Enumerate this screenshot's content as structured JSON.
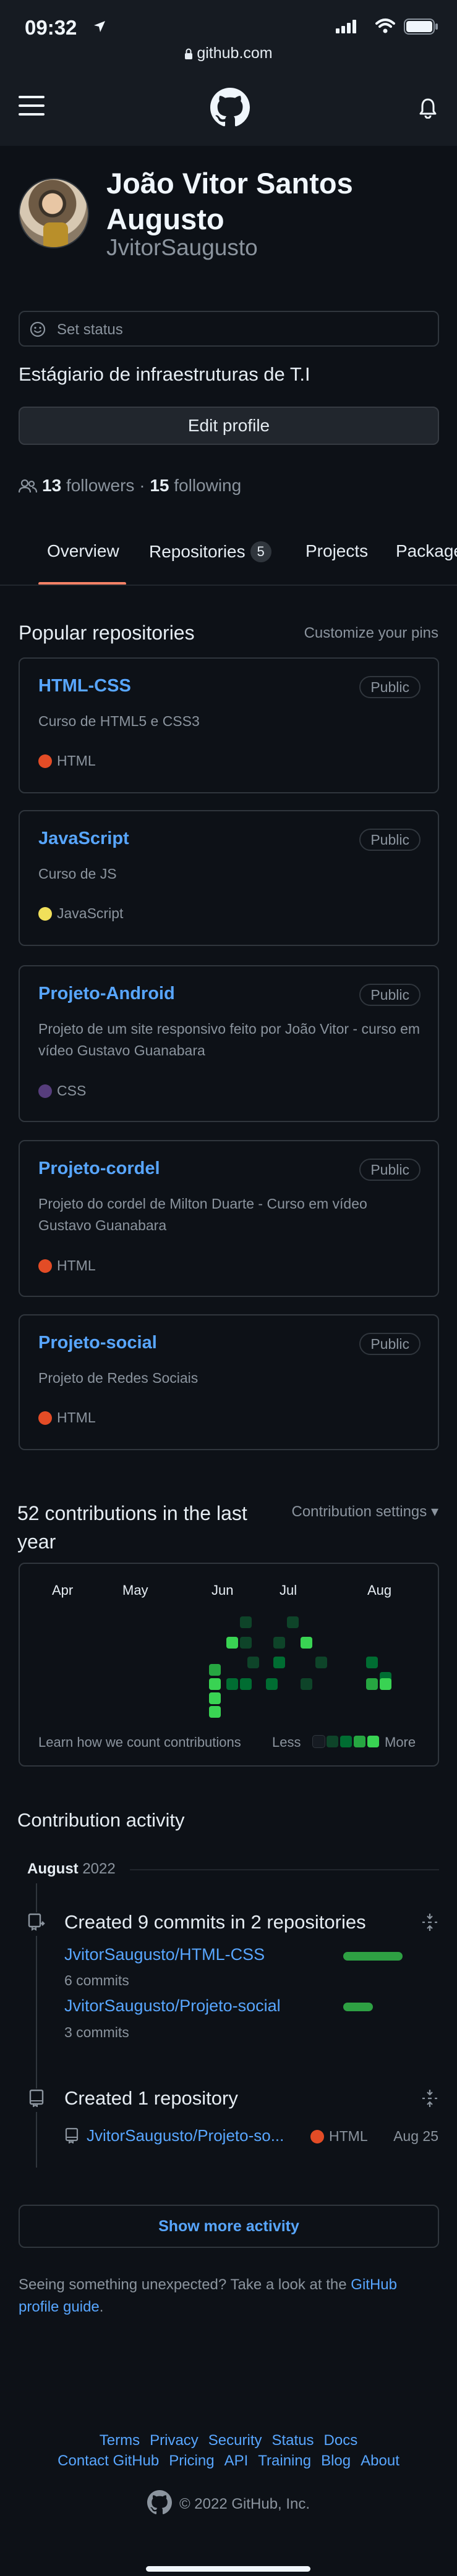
{
  "status_bar": {
    "time": "09:32",
    "url": "github.com"
  },
  "icons": {
    "location": "location-arrow-icon",
    "signal": "cellular-signal-icon",
    "wifi": "wifi-icon",
    "battery": "battery-icon",
    "lock": "lock-icon",
    "menu": "hamburger-menu-icon",
    "logo": "github-logo-icon",
    "bell": "bell-icon",
    "smile": "smiley-icon",
    "people": "people-icon",
    "commit": "repo-push-icon",
    "repo": "repo-icon",
    "fold": "fold-icon"
  },
  "profile": {
    "name": "João Vitor Santos Augusto",
    "login": "JvitorSaugusto",
    "status_placeholder": "Set status",
    "bio": "Estágiario de infraestruturas de T.I",
    "edit_button": "Edit profile",
    "followers_count": "13",
    "followers_label": "followers",
    "separator": "·",
    "following_count": "15",
    "following_label": "following"
  },
  "tabs": [
    {
      "label": "Overview",
      "count": null,
      "selected": true
    },
    {
      "label": "Repositories",
      "count": "5",
      "selected": false
    },
    {
      "label": "Projects",
      "count": null,
      "selected": false
    },
    {
      "label": "Packages",
      "count": null,
      "selected": false
    }
  ],
  "pinned": {
    "title": "Popular repositories",
    "customize": "Customize your pins",
    "repos": [
      {
        "name": "HTML-CSS",
        "visibility": "Public",
        "description": "Curso de HTML5 e CSS3",
        "language": "HTML",
        "language_color": "#e34c26"
      },
      {
        "name": "JavaScript",
        "visibility": "Public",
        "description": "Curso de JS",
        "language": "JavaScript",
        "language_color": "#f1e05a"
      },
      {
        "name": "Projeto-Android",
        "visibility": "Public",
        "description": "Projeto de um site responsivo feito por João Vitor - curso em vídeo Gustavo Guanabara",
        "language": "CSS",
        "language_color": "#563d7c"
      },
      {
        "name": "Projeto-cordel",
        "visibility": "Public",
        "description": "Projeto do cordel de Milton Duarte - Curso em vídeo Gustavo Guanabara",
        "language": "HTML",
        "language_color": "#e34c26"
      },
      {
        "name": "Projeto-social",
        "visibility": "Public",
        "description": "Projeto de Redes Sociais",
        "language": "HTML",
        "language_color": "#e34c26"
      }
    ]
  },
  "contributions": {
    "title": "52 contributions in the last year",
    "settings": "Contribution settings ▾",
    "months": [
      "Apr",
      "May",
      "Jun",
      "Jul",
      "Aug"
    ],
    "learn": "Learn how we count contributions",
    "less": "Less",
    "more": "More",
    "legend_colors": [
      "#161b22",
      "#0e4429",
      "#006d32",
      "#26a641",
      "#39d353"
    ]
  },
  "activity": {
    "title": "Contribution activity",
    "month": "August",
    "year": "2022",
    "commits_title": "Created 9 commits in 2 repositories",
    "commit_repos": [
      {
        "name": "JvitorSaugusto/HTML-CSS",
        "commits": "6 commits",
        "share": 1.0
      },
      {
        "name": "JvitorSaugusto/Projeto-social",
        "commits": "3 commits",
        "share": 0.5
      }
    ],
    "created_title": "Created 1 repository",
    "created_repo": "JvitorSaugusto/Projeto-so...",
    "created_language": "HTML",
    "created_language_color": "#e34c26",
    "created_date": "Aug 25"
  },
  "show_more": "Show more activity",
  "unexpected": {
    "text": "Seeing something unexpected? Take a look at the ",
    "link": "GitHub profile guide",
    "end": "."
  },
  "footer": {
    "row1": [
      "Terms",
      "Privacy",
      "Security",
      "Status",
      "Docs"
    ],
    "row2": [
      "Contact GitHub",
      "Pricing",
      "API",
      "Training",
      "Blog",
      "About"
    ],
    "copyright": "© 2022 GitHub, Inc."
  }
}
